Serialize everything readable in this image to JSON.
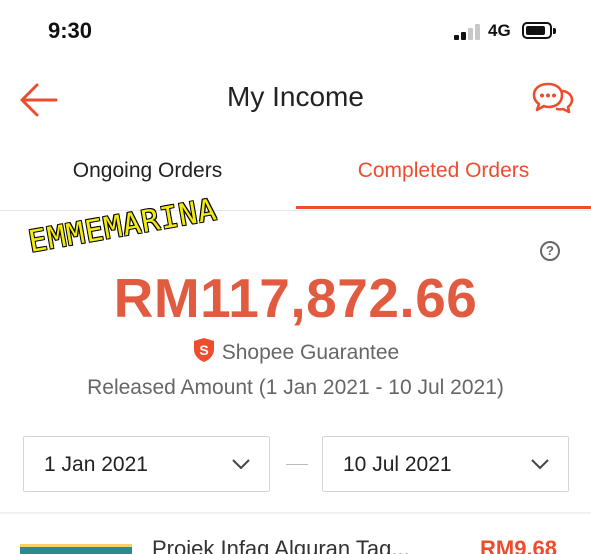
{
  "status_bar": {
    "time": "9:30",
    "network": "4G"
  },
  "header": {
    "title": "My Income"
  },
  "tabs": [
    {
      "label": "Ongoing Orders",
      "active": false
    },
    {
      "label": "Completed Orders",
      "active": true
    }
  ],
  "income": {
    "amount": "RM117,872.66",
    "guarantee_label": "Shopee Guarantee",
    "released_label": "Released Amount (1 Jan 2021 - 10 Jul 2021)",
    "watermark": "EMMEMARINA"
  },
  "date_range": {
    "from": "1 Jan 2021",
    "to": "10 Jul 2021"
  },
  "orders": [
    {
      "title": "Projek Infaq Alquran Tag...",
      "price": "RM9.68"
    }
  ],
  "colors": {
    "accent": "#ee4d2d",
    "amount": "#e05b3f"
  }
}
